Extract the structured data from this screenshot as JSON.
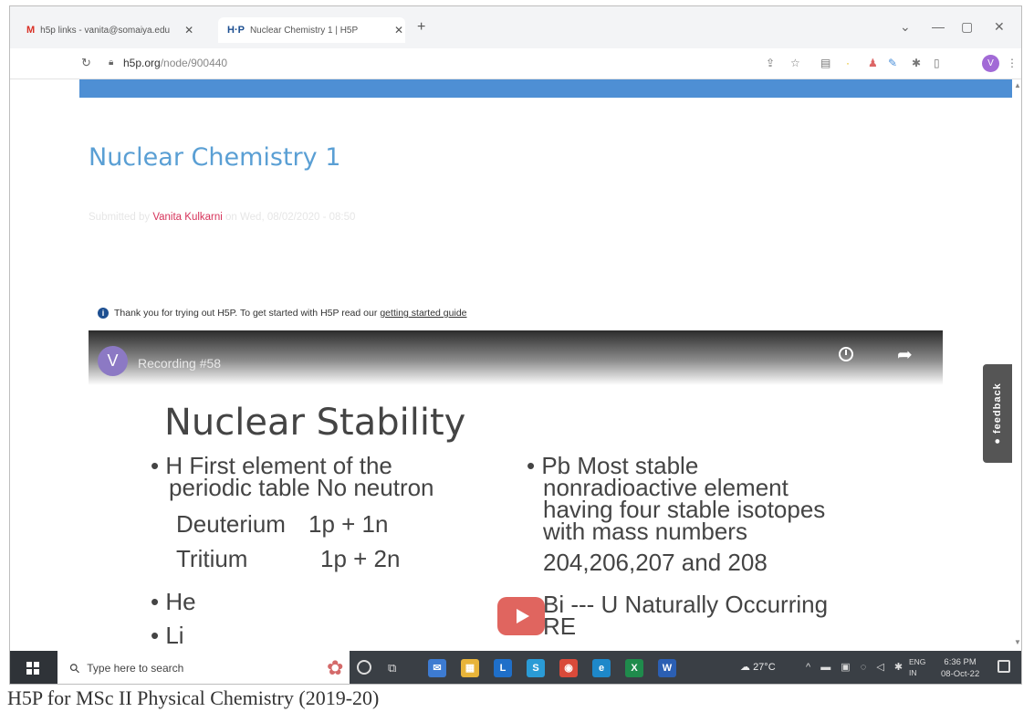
{
  "browser": {
    "tabs": [
      {
        "favicon": "M",
        "title": "h5p links - vanita@somaiya.edu",
        "close": "✕"
      },
      {
        "favicon": "H·P",
        "title": "Nuclear Chemistry 1 | H5P",
        "close": "✕"
      }
    ],
    "new_tab": "+",
    "url_domain": "h5p.org",
    "url_path": "/node/900440",
    "profile_initial": "V",
    "window_controls": [
      "⌄",
      "—",
      "▢",
      "✕"
    ]
  },
  "page": {
    "title": "Nuclear Chemistry 1",
    "submitted_prefix": "Submitted by ",
    "author": "Vanita Kulkarni",
    "submitted_suffix": " on Wed, 08/02/2020 - 08:50",
    "notice_text": "Thank you for trying out H5P. To get started with H5P read our",
    "notice_link": "getting started guide",
    "feedback_label": "● feedback"
  },
  "video": {
    "channel_initial": "V",
    "title": "Recording #58",
    "slide": {
      "title": "Nuclear Stability",
      "left_bullets": [
        "• H  First element of the",
        "periodic table  No neutron",
        "• He",
        "• Li"
      ],
      "isotopes": [
        {
          "name": "Deuterium",
          "composition": "1p + 1n"
        },
        {
          "name": "Tritium",
          "composition": "1p + 2n"
        }
      ],
      "right_lines": [
        "• Pb  Most stable",
        "nonradioactive element",
        "having four stable isotopes",
        "with mass numbers",
        "204,206,207 and 208",
        "Bi --- U  Naturally Occurring",
        "RE"
      ]
    }
  },
  "taskbar": {
    "search_placeholder": "Type here to search",
    "apps": [
      {
        "label": "✉",
        "color": "#3d7bd1"
      },
      {
        "label": "▦",
        "color": "#e8b43a"
      },
      {
        "label": "L",
        "color": "#1f6fc9"
      },
      {
        "label": "S",
        "color": "#2a9bd6"
      },
      {
        "label": "◉",
        "color": "#d94a3a"
      },
      {
        "label": "e",
        "color": "#1e88c9"
      },
      {
        "label": "X",
        "color": "#1f8b4c"
      },
      {
        "label": "W",
        "color": "#2b5fb3"
      }
    ],
    "weather": "27°C",
    "lang_line1": "ENG",
    "lang_line2": "IN",
    "time": "6:36 PM",
    "date": "08-Oct-22"
  },
  "caption": "H5P for MSc II Physical Chemistry (2019-20)"
}
